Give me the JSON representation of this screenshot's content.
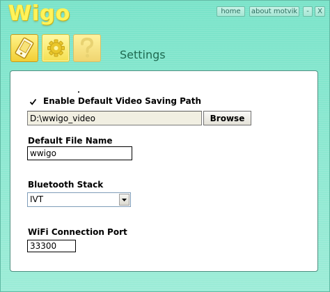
{
  "app": {
    "logo_text": "Wigo"
  },
  "titlebar": {
    "home_label": "home",
    "about_label": "about motvik",
    "minimize_label": "-",
    "close_label": "X"
  },
  "toolbar": {
    "icons": [
      "device-icon",
      "settings-gear-icon",
      "help-question-icon"
    ],
    "active": "settings-gear-icon"
  },
  "page": {
    "title": "Settings"
  },
  "settings": {
    "video_path": {
      "checkbox_label": "Enable Default Video Saving Path",
      "checked": true,
      "value": "D:\\wwigo_video",
      "browse_label": "Browse"
    },
    "file_name": {
      "label": "Default File Name",
      "value": "wwigo"
    },
    "bluetooth": {
      "label": "Bluetooth Stack",
      "selected": "IVT"
    },
    "wifi": {
      "label": "WiFi Connection Port",
      "value": "33300"
    }
  },
  "colors": {
    "background": "#8fe9d2",
    "logo": "#fff35a",
    "title": "#1f6a51",
    "panel_border": "#4d8f80"
  }
}
